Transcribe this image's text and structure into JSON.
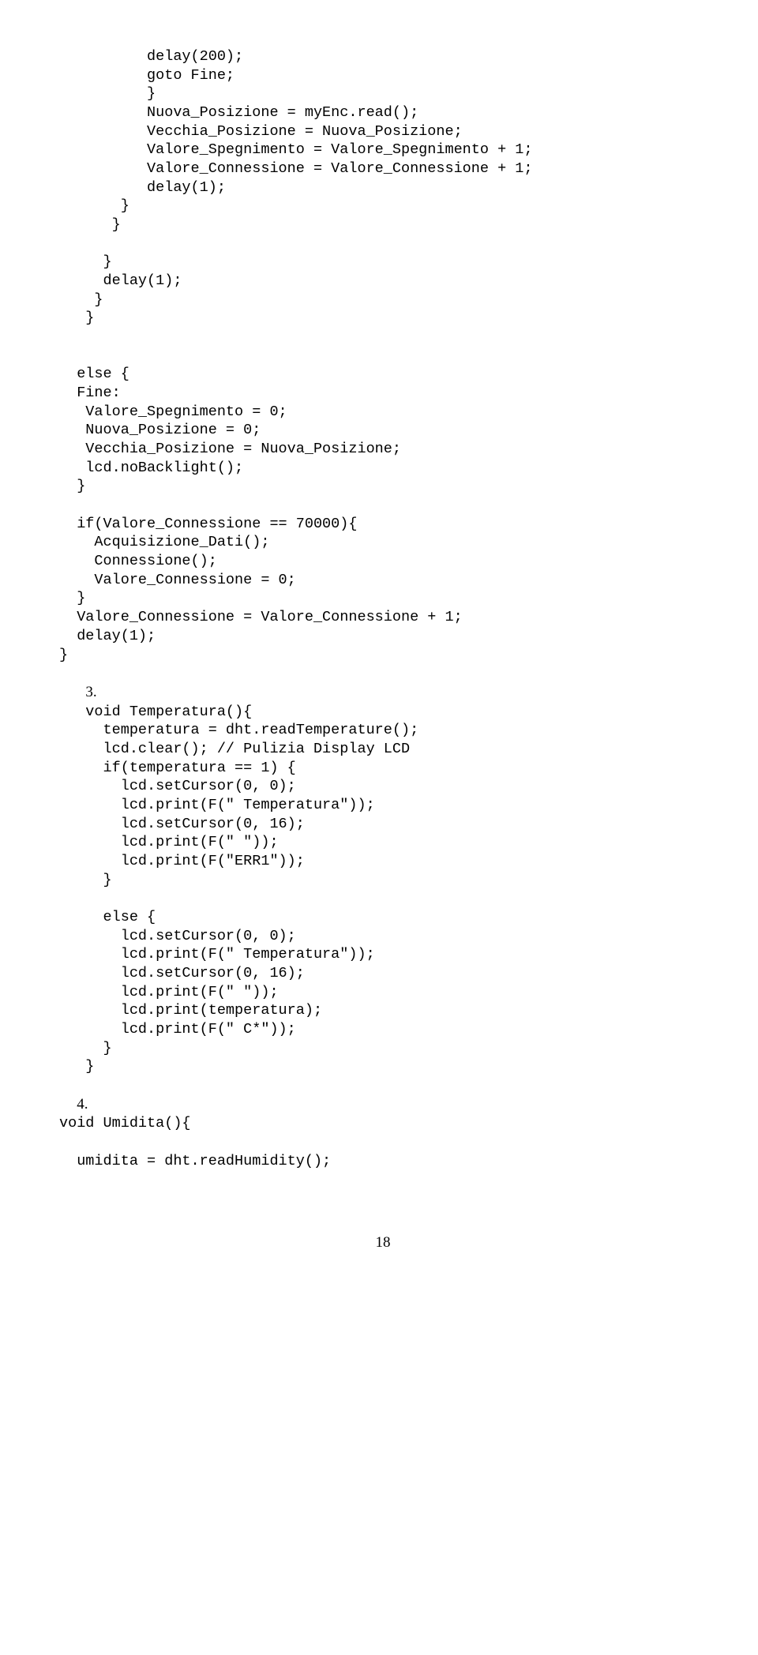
{
  "code": {
    "block1": "          delay(200);\n          goto Fine;\n          }\n          Nuova_Posizione = myEnc.read();\n          Vecchia_Posizione = Nuova_Posizione;\n          Valore_Spegnimento = Valore_Spegnimento + 1;\n          Valore_Connessione = Valore_Connessione + 1;\n          delay(1);\n       }\n      }",
    "block2": "     }\n     delay(1);\n    }\n   }",
    "block3": "  else {\n  Fine:\n   Valore_Spegnimento = 0;\n   Nuova_Posizione = 0;\n   Vecchia_Posizione = Nuova_Posizione;\n   lcd.noBacklight();\n  }",
    "block4": "  if(Valore_Connessione == 70000){\n    Acquisizione_Dati();\n    Connessione();\n    Valore_Connessione = 0;\n  }\n  Valore_Connessione = Valore_Connessione + 1;\n  delay(1);\n}",
    "item3_num": "3.",
    "block5": "   void Temperatura(){\n     temperatura = dht.readTemperature();\n     lcd.clear(); // Pulizia Display LCD\n     if(temperatura == 1) {\n       lcd.setCursor(0, 0);\n       lcd.print(F(\" Temperatura\"));\n       lcd.setCursor(0, 16);\n       lcd.print(F(\" \"));\n       lcd.print(F(\"ERR1\"));\n     }",
    "block6": "     else {\n       lcd.setCursor(0, 0);\n       lcd.print(F(\" Temperatura\"));\n       lcd.setCursor(0, 16);\n       lcd.print(F(\" \"));\n       lcd.print(temperatura);\n       lcd.print(F(\" C*\"));\n     }\n   }",
    "item4_num": "4.",
    "block7": "void Umidita(){",
    "block8": "  umidita = dht.readHumidity();"
  },
  "page_number": "18"
}
